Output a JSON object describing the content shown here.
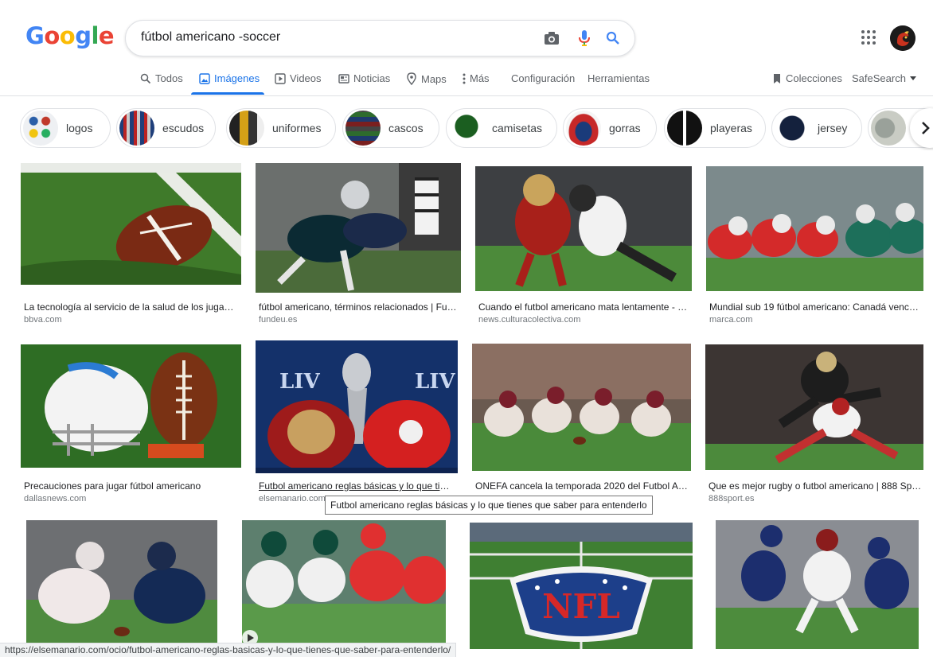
{
  "logo": {
    "letters": [
      "G",
      "o",
      "o",
      "g",
      "l",
      "e"
    ],
    "colors": [
      "#4285f4",
      "#ea4335",
      "#fbbc05",
      "#4285f4",
      "#34a853",
      "#ea4335"
    ]
  },
  "search": {
    "query": "fútbol americano -soccer"
  },
  "tabs": [
    {
      "label": "Todos",
      "icon": "search-icon"
    },
    {
      "label": "Imágenes",
      "icon": "image-icon",
      "active": true
    },
    {
      "label": "Videos",
      "icon": "play-icon"
    },
    {
      "label": "Noticias",
      "icon": "newspaper-icon"
    },
    {
      "label": "Maps",
      "icon": "map-pin-icon"
    },
    {
      "label": "Más",
      "icon": "more-vert-icon"
    },
    {
      "label": "Configuración"
    },
    {
      "label": "Herramientas"
    }
  ],
  "right_tools": {
    "collections": "Colecciones",
    "safesearch": "SafeSearch"
  },
  "chips": [
    {
      "label": "logos"
    },
    {
      "label": "escudos"
    },
    {
      "label": "uniformes"
    },
    {
      "label": "cascos"
    },
    {
      "label": "camisetas"
    },
    {
      "label": "gorras"
    },
    {
      "label": "playeras"
    },
    {
      "label": "jersey"
    }
  ],
  "results": [
    {
      "title": "La tecnología al servicio de la salud de los jugador...",
      "source": "bbva.com"
    },
    {
      "title": "fútbol americano, términos relacionados | Fund...",
      "source": "fundeu.es"
    },
    {
      "title": "Cuando el futbol americano mata lentamente - mu...",
      "source": "news.culturacolectiva.com"
    },
    {
      "title": "Mundial sub 19 fútbol americano: Canadá vence a...",
      "source": "marca.com"
    },
    {
      "title": "Precauciones para jugar fútbol americano",
      "source": "dallasnews.com"
    },
    {
      "title": "Futbol americano reglas básicas y lo que tiene...",
      "source": "elsemanario.com"
    },
    {
      "title": "ONEFA cancela la temporada 2020 del Futbol Ame...",
      "source": ""
    },
    {
      "title": "Que es mejor rugby o futbol americano | 888 Sport",
      "source": "888sport.es"
    }
  ],
  "nfl_logo_text": "NFL",
  "lv_text": "LIV",
  "tooltip": "Futbol americano reglas básicas y lo que tienes que saber para entenderlo",
  "status_url": "https://elsemanario.com/ocio/futbol-americano-reglas-basicas-y-lo-que-tienes-que-saber-para-entenderlo/"
}
